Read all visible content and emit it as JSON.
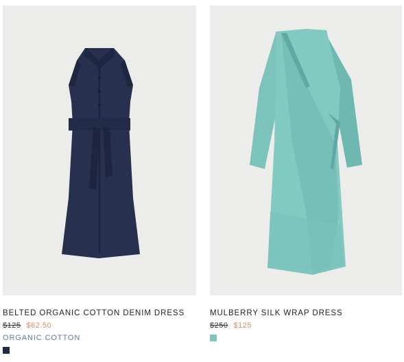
{
  "products": [
    {
      "name": "BELTED ORGANIC COTTON DENIM DRESS",
      "price_original": "$125",
      "price_sale": "$62.50",
      "tag": "ORGANIC COTTON",
      "swatch_color": "#1f2a45",
      "image_icon": "denim-dress-image"
    },
    {
      "name": "MULBERRY SILK WRAP DRESS",
      "price_original": "$250",
      "price_sale": "$125",
      "swatch_color": "#7fc4bd",
      "image_icon": "silk-wrap-dress-image"
    }
  ]
}
